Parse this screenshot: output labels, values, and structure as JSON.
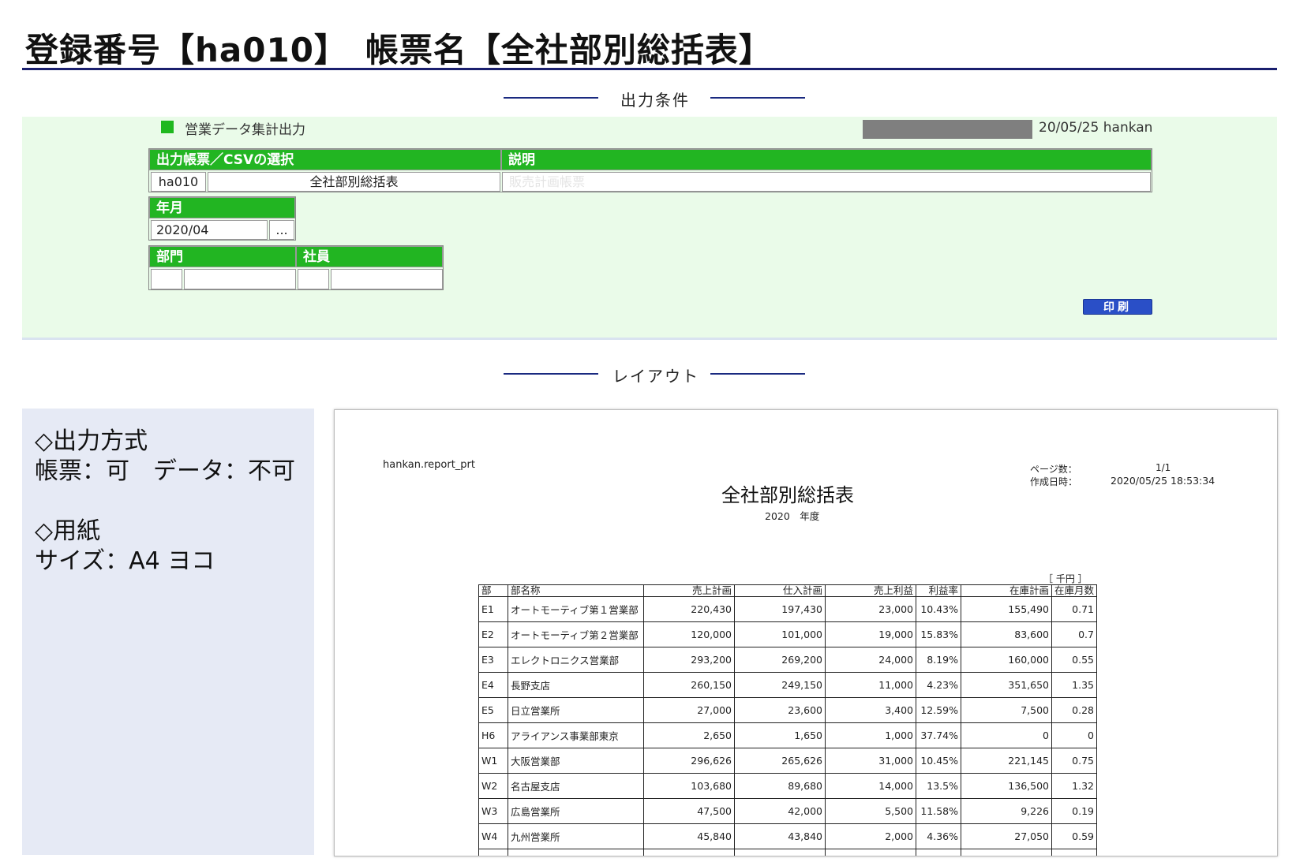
{
  "page": {
    "title": "登録番号【ha010】　帳票名【全社部別総括表】",
    "section_conditions": "出力条件",
    "section_layout": "レイアウト"
  },
  "screen": {
    "title": "営業データ集計出力",
    "date_user": "20/05/25 hankan",
    "report_header": "出力帳票／CSVの選択",
    "description_header": "説明",
    "report_code": "ha010",
    "report_name": "全社部別総括表",
    "description": "販売計画帳票",
    "yearmonth_header": "年月",
    "yearmonth_value": "2020/04",
    "picker_label": "...",
    "dept_header": "部門",
    "emp_header": "社員",
    "dept_code": "",
    "dept_name": "",
    "emp_code": "",
    "emp_name": "",
    "print_button": "印刷"
  },
  "info": {
    "output_heading": "◇出力方式",
    "output_value": "帳票：可　データ：不可",
    "paper_heading": "◇用紙",
    "paper_value": "サイズ：A4 ヨコ"
  },
  "report": {
    "program": "hankan.report_prt",
    "title": "全社部別総括表",
    "fiscal_year": "2020　年度",
    "page_label": "ページ数：",
    "page_value": "1/1",
    "created_label": "作成日時：",
    "created_value": "2020/05/25 18:53:34",
    "unit": "［ 千円 ］",
    "columns": [
      "部",
      "部名称",
      "売上計画",
      "仕入計画",
      "売上利益",
      "利益率",
      "在庫計画",
      "在庫月数"
    ],
    "rows": [
      [
        "E1",
        "オートモーティブ第１営業部",
        "220,430",
        "197,430",
        "23,000",
        "10.43%",
        "155,490",
        "0.71"
      ],
      [
        "E2",
        "オートモーティブ第２営業部",
        "120,000",
        "101,000",
        "19,000",
        "15.83%",
        "83,600",
        "0.7"
      ],
      [
        "E3",
        "エレクトロニクス営業部",
        "293,200",
        "269,200",
        "24,000",
        "8.19%",
        "160,000",
        "0.55"
      ],
      [
        "E4",
        "長野支店",
        "260,150",
        "249,150",
        "11,000",
        "4.23%",
        "351,650",
        "1.35"
      ],
      [
        "E5",
        "日立営業所",
        "27,000",
        "23,600",
        "3,400",
        "12.59%",
        "7,500",
        "0.28"
      ],
      [
        "H6",
        "アライアンス事業部東京",
        "2,650",
        "1,650",
        "1,000",
        "37.74%",
        "0",
        "0"
      ],
      [
        "W1",
        "大阪営業部",
        "296,626",
        "265,626",
        "31,000",
        "10.45%",
        "221,145",
        "0.75"
      ],
      [
        "W2",
        "名古屋支店",
        "103,680",
        "89,680",
        "14,000",
        "13.5%",
        "136,500",
        "1.32"
      ],
      [
        "W3",
        "広島営業所",
        "47,500",
        "42,000",
        "5,500",
        "11.58%",
        "9,226",
        "0.19"
      ],
      [
        "W4",
        "九州営業所",
        "45,840",
        "43,840",
        "2,000",
        "4.36%",
        "27,050",
        "0.59"
      ],
      [
        "",
        "",
        "",
        "",
        "",
        "",
        "",
        ""
      ]
    ]
  }
}
